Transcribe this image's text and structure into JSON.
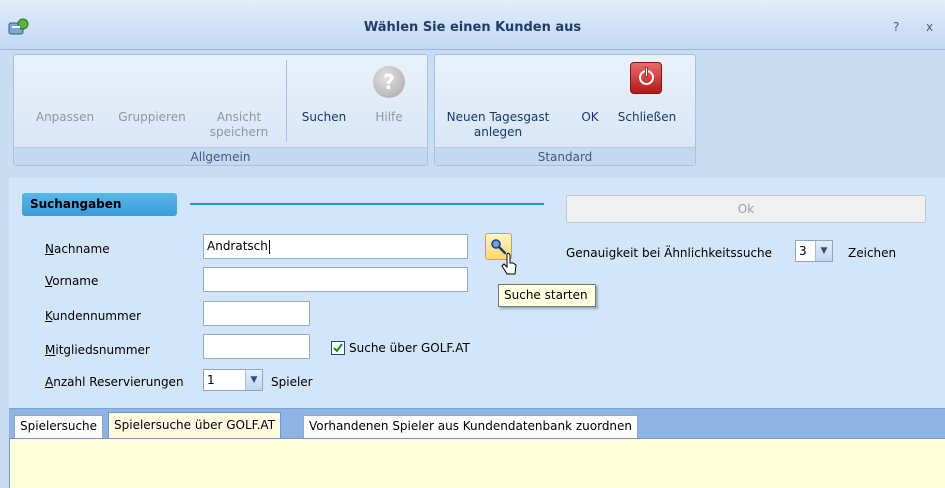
{
  "window": {
    "title": "Wählen Sie einen Kunden aus",
    "btn_help": "?",
    "btn_close": "x"
  },
  "ribbon": {
    "groups": {
      "allgemein": "Allgemein",
      "standard": "Standard"
    },
    "anpassen": "Anpassen",
    "gruppieren": "Gruppieren",
    "ansicht_l1": "Ansicht",
    "ansicht_l2": "speichern",
    "suchen": "Suchen",
    "hilfe": "Hilfe",
    "neuer_gast_l1": "Neuen Tagesgast",
    "neuer_gast_l2": "anlegen",
    "ok": "OK",
    "schliessen": "Schließen",
    "help_glyph": "?"
  },
  "search": {
    "section_title": "Suchangaben",
    "ok_button": "Ok",
    "labels": {
      "nachname_first": "N",
      "nachname_rest": "achname",
      "vorname_first": "V",
      "vorname_rest": "orname",
      "kundennummer_first": "K",
      "kundennummer_rest": "undennummer",
      "mitglied_first": "M",
      "mitglied_rest": "itgliedsnummer",
      "anzahl_first": "A",
      "anzahl_rest": "nzahl Reservierungen"
    },
    "nachname_value": "Andratsch",
    "vorname_value": "",
    "kundennummer_value": "",
    "mitgliedsnummer_value": "",
    "golf_checkbox_label": "Suche über GOLF.AT",
    "golf_checkbox_checked": true,
    "anzahl_value": "1",
    "spieler_label": "Spieler",
    "tooltip": "Suche starten",
    "genauigkeit_label": "Genauigkeit bei Ähnlichkeitssuche",
    "genauigkeit_value": "3",
    "zeichen_label": "Zeichen"
  },
  "tabs": [
    {
      "label": "Spielersuche",
      "active": false
    },
    {
      "label": "Spielersuche über GOLF.AT",
      "active": true
    },
    {
      "label": "Vorhandenen Spieler aus Kundendatenbank zuordnen",
      "active": false
    }
  ],
  "colors": {
    "accent": "#3a9cd8",
    "title_text": "#1f3d6b",
    "close_red": "#b81818"
  }
}
